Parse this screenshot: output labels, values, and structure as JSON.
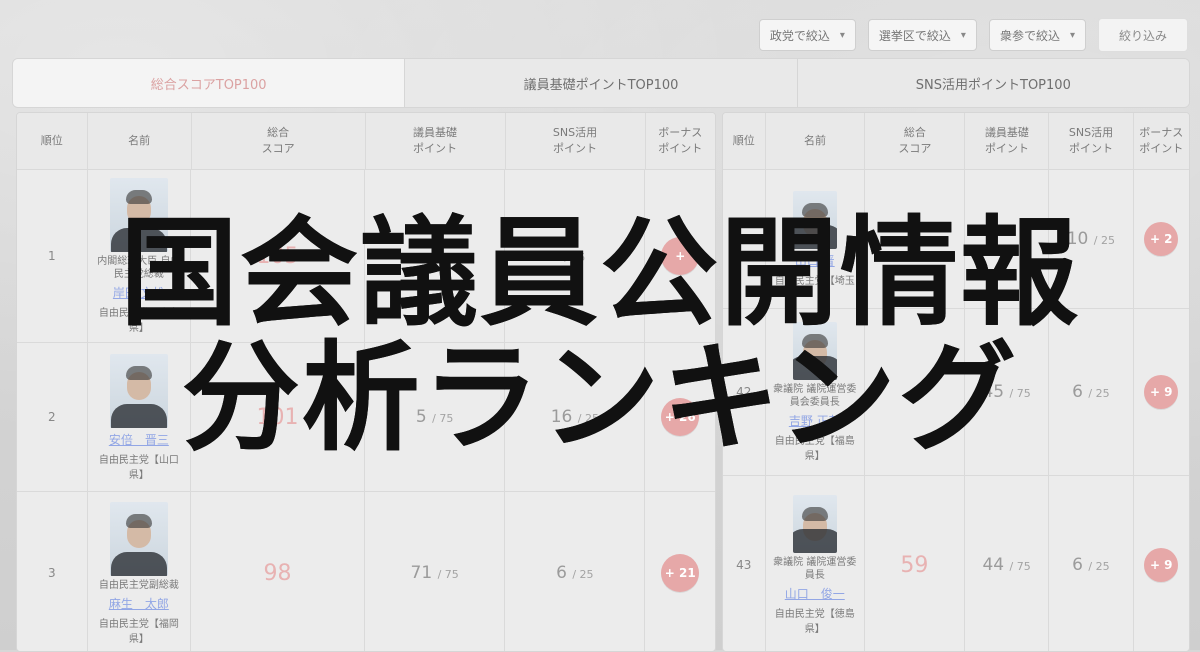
{
  "filters": {
    "party_placeholder": "政党で絞込",
    "district_placeholder": "選挙区で絞込",
    "chamber_placeholder": "衆参で絞込",
    "apply_label": "絞り込み"
  },
  "tabs": [
    {
      "label": "総合スコアTOP100"
    },
    {
      "label": "議員基礎ポイントTOP100"
    },
    {
      "label": "SNS活用ポイントTOP100"
    }
  ],
  "left_table": {
    "headers": [
      "順位",
      "名前",
      "総合\nスコア",
      "議員基礎\nポイント",
      "SNS活用\nポイント",
      "ボーナス\nポイント"
    ],
    "rows": [
      {
        "rank": "1",
        "role": "内閣総理大臣 自由民主党総裁",
        "name": "岸田 文雄",
        "party": "自由民主党【広島県】",
        "score": "105",
        "base": "",
        "sns": "",
        "sns_max": "/ 25",
        "bonus": "+"
      },
      {
        "rank": "2",
        "role": "",
        "name": "安倍　晋三",
        "party": "自由民主党【山口県】",
        "score": "101",
        "base": "5",
        "base_max": "/ 75",
        "sns": "16",
        "sns_max": "/ 25",
        "bonus": "+ 26"
      },
      {
        "rank": "3",
        "role": "自由民主党副総裁",
        "name": "麻生　太郎",
        "party": "自由民主党【福岡県】",
        "score": "98",
        "base": "71",
        "base_max": "/ 75",
        "sns": "6",
        "sns_max": "/ 25",
        "bonus": "+ 21"
      }
    ]
  },
  "right_table": {
    "headers": [
      "順位",
      "名前",
      "総合\nスコア",
      "議員基礎\nポイント",
      "SNS活用\nポイント",
      "ボーナス\nポイント"
    ],
    "rows": [
      {
        "rank": "",
        "role": "",
        "name": "山口 晋",
        "party": "自由民主党【埼玉",
        "score": "",
        "base": "",
        "sns": "10",
        "sns_max": "/ 25",
        "bonus": "+ 2"
      },
      {
        "rank": "42",
        "role": "衆議院 議院運営委員会委員長",
        "name": "吉野 正芳",
        "party": "自由民主党【福島県】",
        "score": "",
        "base": "45",
        "base_max": "/ 75",
        "sns": "6",
        "sns_max": "/ 25",
        "bonus": "+ 9"
      },
      {
        "rank": "43",
        "role": "衆議院 議院運営委員長",
        "name": "山口　俊一",
        "party": "自由民主党【徳島県】",
        "score": "59",
        "base": "44",
        "base_max": "/ 75",
        "sns": "6",
        "sns_max": "/ 25",
        "bonus": "+ 9"
      }
    ]
  },
  "overlay": {
    "line1": "国会議員公開情報",
    "line2": "分析ランキング"
  }
}
